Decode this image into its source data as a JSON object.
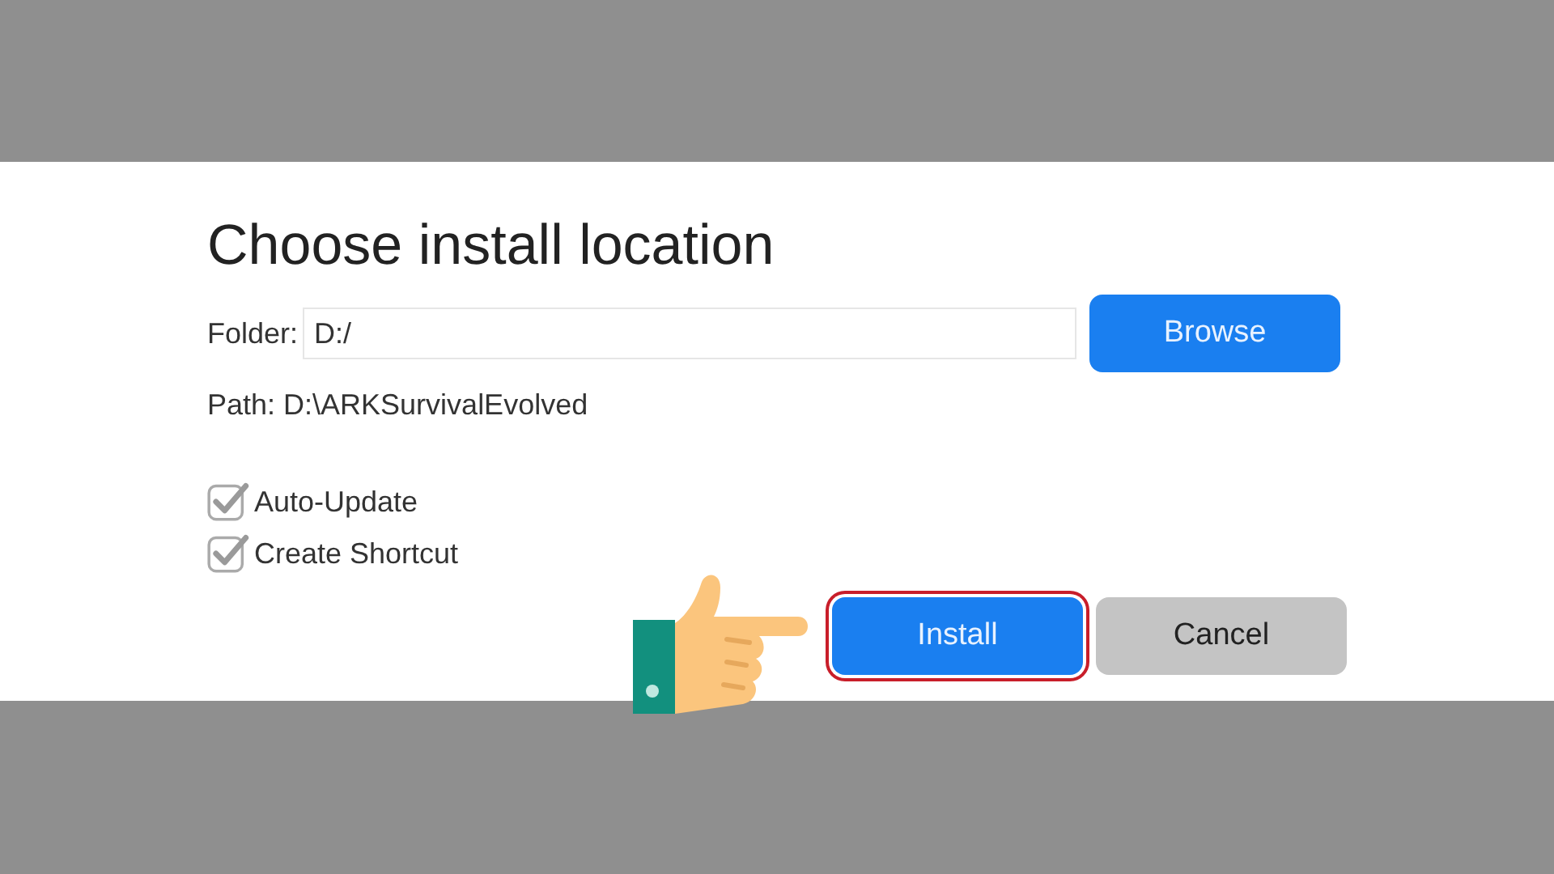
{
  "dialog": {
    "title": "Choose install location",
    "folder": {
      "label": "Folder:",
      "value": "D:/"
    },
    "browse_button": "Browse",
    "path": "Path: D:\\ARKSurvivalEvolved",
    "options": [
      {
        "label": "Auto-Update",
        "checked": true
      },
      {
        "label": "Create Shortcut",
        "checked": true
      }
    ],
    "buttons": [
      {
        "label": "Install",
        "kind": "primary",
        "highlighted": true
      },
      {
        "label": "Cancel",
        "kind": "secondary",
        "highlighted": false
      }
    ]
  }
}
